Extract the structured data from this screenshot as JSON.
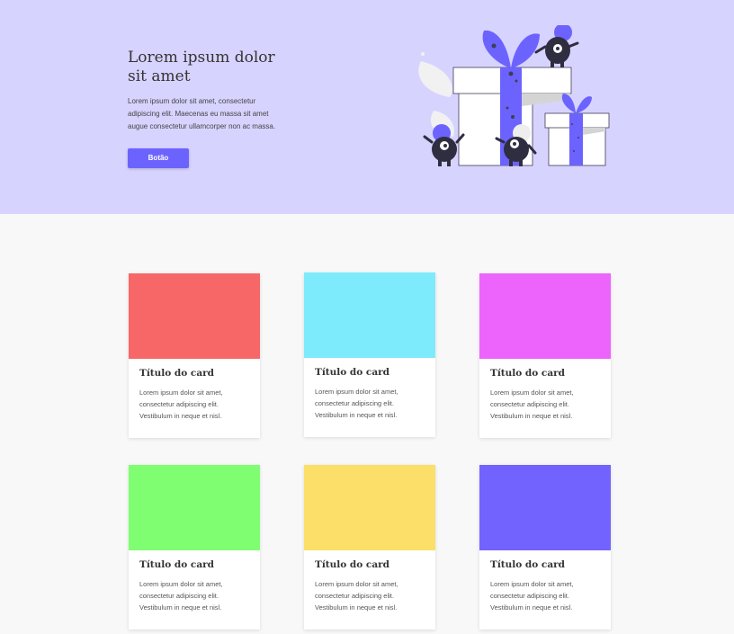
{
  "hero": {
    "title": "Lorem ipsum dolor sit amet",
    "description": "Lorem ipsum dolor sit amet, consectetur adipiscing elit. Maecenas eu massa sit amet augue consectetur ullamcorper non ac massa.",
    "button_label": "Botão",
    "colors": {
      "background": "#d7d3ff",
      "accent": "#6c63ff"
    },
    "illustration": "gift-boxes-with-monsters"
  },
  "cards": [
    {
      "title": "Título do card",
      "text": "Lorem ipsum dolor sit amet, consectetur adipiscing elit. Vestibulum in neque et nisl.",
      "color": "#f76767"
    },
    {
      "title": "Título do card",
      "text": "Lorem ipsum dolor sit amet, consectetur adipiscing elit. Vestibulum in neque et nisl.",
      "color": "#7eebfd"
    },
    {
      "title": "Título do card",
      "text": "Lorem ipsum dolor sit amet, consectetur adipiscing elit. Vestibulum in neque et nisl.",
      "color": "#ec64fb"
    },
    {
      "title": "Título do card",
      "text": "Lorem ipsum dolor sit amet, consectetur adipiscing elit. Vestibulum in neque et nisl.",
      "color": "#7ffe72"
    },
    {
      "title": "Título do card",
      "text": "Lorem ipsum dolor sit amet, consectetur adipiscing elit. Vestibulum in neque et nisl.",
      "color": "#fbdf68"
    },
    {
      "title": "Título do card",
      "text": "Lorem ipsum dolor sit amet, consectetur adipiscing elit. Vestibulum in neque et nisl.",
      "color": "#7263ff"
    }
  ]
}
